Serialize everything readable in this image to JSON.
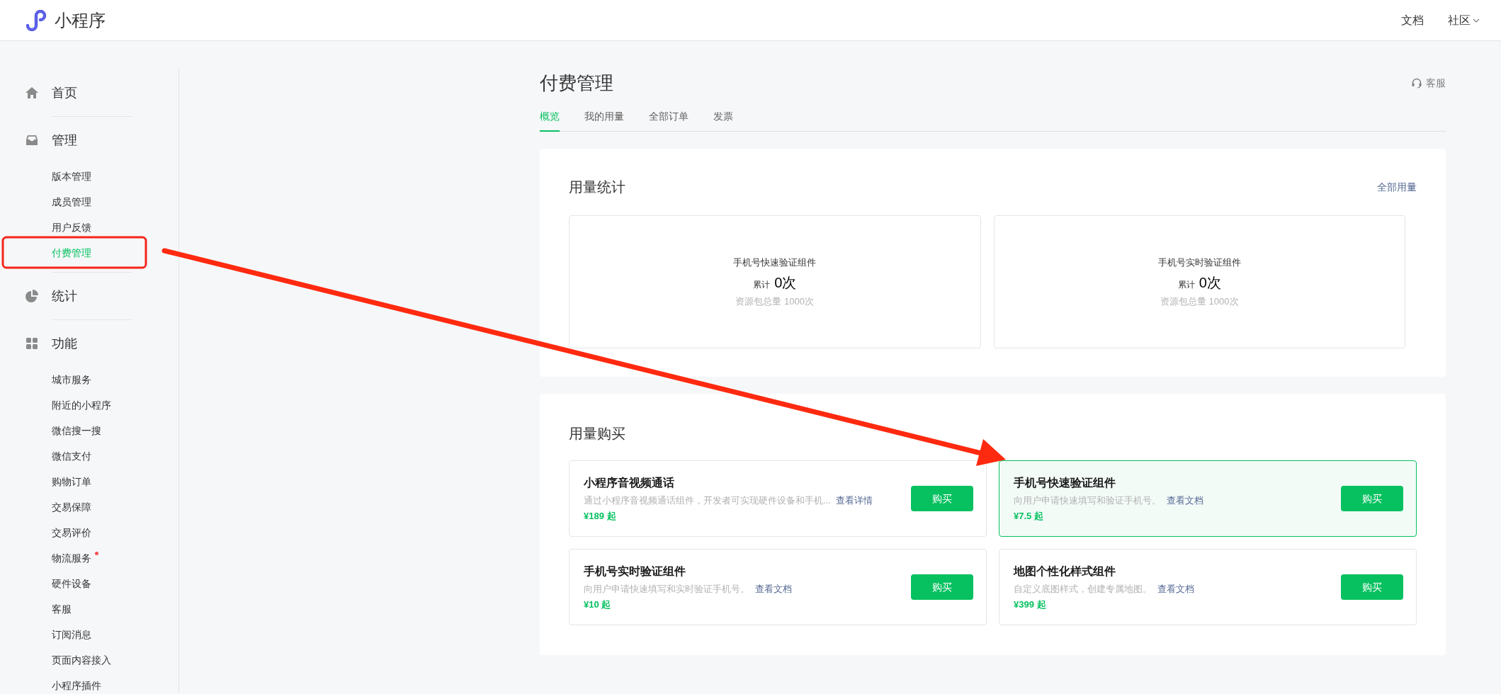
{
  "header": {
    "logo_text": "小程序",
    "links": [
      {
        "label": "文档",
        "dropdown": false
      },
      {
        "label": "社区",
        "dropdown": true
      }
    ]
  },
  "sidebar": {
    "groups": [
      {
        "label": "首页"
      },
      {
        "label": "管理",
        "children": [
          {
            "label": "版本管理",
            "selected": false,
            "dot": false
          },
          {
            "label": "成员管理",
            "selected": false,
            "dot": false
          },
          {
            "label": "用户反馈",
            "selected": false,
            "dot": false
          },
          {
            "label": "付费管理",
            "selected": true,
            "dot": false
          }
        ]
      },
      {
        "label": "统计"
      },
      {
        "label": "功能",
        "children": [
          {
            "label": "城市服务",
            "selected": false,
            "dot": false
          },
          {
            "label": "附近的小程序",
            "selected": false,
            "dot": false
          },
          {
            "label": "微信搜一搜",
            "selected": false,
            "dot": false
          },
          {
            "label": "微信支付",
            "selected": false,
            "dot": false
          },
          {
            "label": "购物订单",
            "selected": false,
            "dot": false
          },
          {
            "label": "交易保障",
            "selected": false,
            "dot": false
          },
          {
            "label": "交易评价",
            "selected": false,
            "dot": false
          },
          {
            "label": "物流服务",
            "selected": false,
            "dot": true
          },
          {
            "label": "硬件设备",
            "selected": false,
            "dot": false
          },
          {
            "label": "客服",
            "selected": false,
            "dot": false
          },
          {
            "label": "订阅消息",
            "selected": false,
            "dot": false
          },
          {
            "label": "页面内容接入",
            "selected": false,
            "dot": false
          },
          {
            "label": "小程序插件",
            "selected": false,
            "dot": false
          }
        ]
      }
    ]
  },
  "page": {
    "title": "付费管理",
    "service_link": "客服",
    "tabs": [
      {
        "label": "概览",
        "selected": true
      },
      {
        "label": "我的用量",
        "selected": false
      },
      {
        "label": "全部订单",
        "selected": false
      },
      {
        "label": "发票",
        "selected": false
      }
    ],
    "usage": {
      "title": "用量统计",
      "link": "全部用量",
      "stats": [
        {
          "name": "手机号快速验证组件",
          "label": "累计",
          "count": "0次",
          "total": "资源包总量 1000次"
        },
        {
          "name": "手机号实时验证组件",
          "label": "累计",
          "count": "0次",
          "total": "资源包总量 1000次"
        }
      ]
    },
    "purchase": {
      "title": "用量购买",
      "products": [
        {
          "title": "小程序音视频通话",
          "description": "通过小程序音视频通话组件，开发者可实现硬件设备和手机...",
          "link": "查看详情",
          "price": "¥189 起",
          "button": "购买",
          "selected": false
        },
        {
          "title": "手机号快速验证组件",
          "description": "向用户申请快速填写和验证手机号。",
          "link": "查看文档",
          "price": "¥7.5 起",
          "button": "购买",
          "selected": true
        },
        {
          "title": "手机号实时验证组件",
          "description": "向用户申请快速填写和实时验证手机号。",
          "link": "查看文档",
          "price": "¥10 起",
          "button": "购买",
          "selected": false
        },
        {
          "title": "地图个性化样式组件",
          "description": "自定义底图样式，创建专属地图。",
          "link": "查看文档",
          "price": "¥399 起",
          "button": "购买",
          "selected": false
        }
      ]
    }
  }
}
